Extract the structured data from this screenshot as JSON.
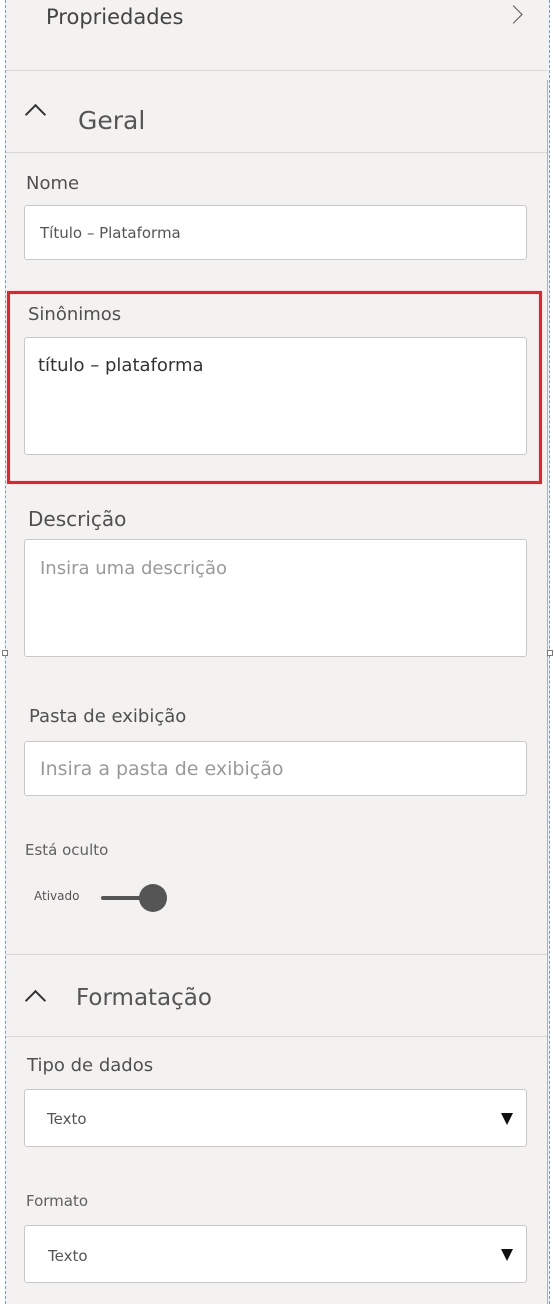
{
  "header": {
    "title": "Propriedades",
    "expand_icon": "chevron-right-icon"
  },
  "sections": {
    "geral": {
      "title": "Geral",
      "toggle_icon": "chevron-up-icon",
      "nome": {
        "label": "Nome",
        "value": "Título – Plataforma"
      },
      "sinonimos": {
        "label": "Sinônimos",
        "value": "título – plataforma"
      },
      "descricao": {
        "label": "Descrição",
        "placeholder": "Insira uma descrição"
      },
      "pasta": {
        "label": "Pasta de exibição",
        "placeholder": "Insira a pasta de exibição"
      },
      "oculto": {
        "label": "Está oculto",
        "state_label": "Ativado",
        "on": true
      }
    },
    "formatacao": {
      "title": "Formatação",
      "toggle_icon": "chevron-up-icon",
      "tipo_dados": {
        "label": "Tipo de dados",
        "value": "Texto",
        "dropdown_icon": "caret-down-icon"
      },
      "formato": {
        "label": "Formato",
        "value": "Texto",
        "dropdown_icon": "caret-down-icon"
      }
    }
  },
  "colors": {
    "highlight": "#e0252b",
    "panel": "#f3f2f1",
    "selection_border": "#6aa2d8"
  }
}
